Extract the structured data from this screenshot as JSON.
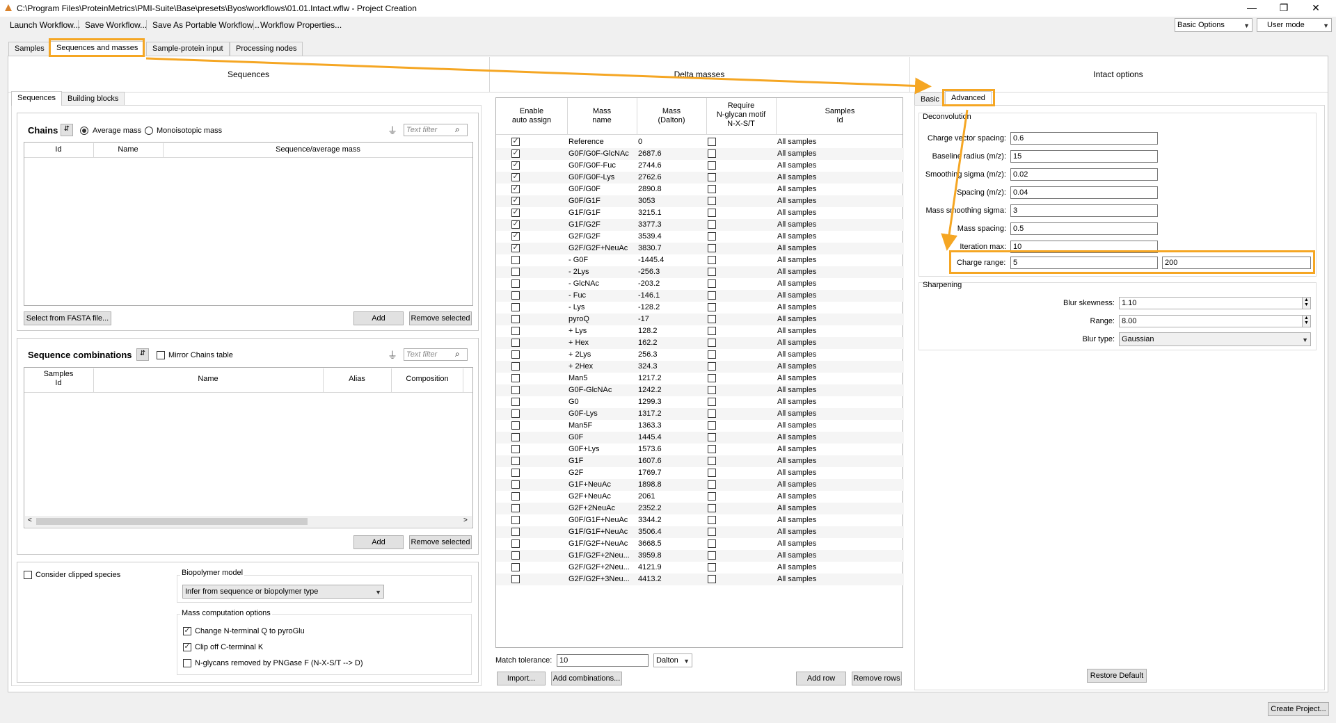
{
  "window": {
    "title": "C:\\Program Files\\ProteinMetrics\\PMI-Suite\\Base\\presets\\Byos\\workflows\\01.01.Intact.wflw - Project Creation",
    "minimize": "—",
    "restore": "❐",
    "close": "✕"
  },
  "menu": {
    "items": [
      "Launch Workflow...",
      "Save Workflow...",
      "Save As Portable Workflow...",
      "Workflow Properties..."
    ],
    "options_combo": "Basic Options",
    "mode_combo": "User mode"
  },
  "main_tabs": [
    "Samples",
    "Sequences and masses",
    "Sample-protein input",
    "Processing nodes"
  ],
  "sections": {
    "sequences": "Sequences",
    "delta": "Delta masses",
    "intact": "Intact options"
  },
  "seq_subtabs": [
    "Sequences",
    "Building blocks"
  ],
  "chains": {
    "title": "Chains",
    "avg_label": "Average mass",
    "mono_label": "Monoisotopic mass",
    "filter_placeholder": "Text filter",
    "headers": [
      "Id",
      "Name",
      "Sequence/average mass"
    ],
    "fasta_button": "Select from FASTA file...",
    "add": "Add",
    "remove": "Remove selected"
  },
  "combos": {
    "title": "Sequence combinations",
    "mirror_label": "Mirror Chains table",
    "filter_placeholder": "Text filter",
    "headers": [
      "Samples\nId",
      "Name",
      "Alias",
      "Composition"
    ],
    "add": "Add",
    "remove": "Remove selected"
  },
  "bottom_opts": {
    "clipped": "Consider clipped species",
    "biopolymer_label": "Biopolymer model",
    "biopolymer_value": "Infer from sequence or biopolymer type",
    "mass_comp_label": "Mass computation options",
    "opt1": "Change N-terminal Q to pyroGlu",
    "opt2": "Clip off C-terminal K",
    "opt3": "N-glycans removed by PNGase F (N-X-S/T --> D)"
  },
  "delta": {
    "headers": [
      "Enable\nauto assign",
      "Mass\nname",
      "Mass\n(Dalton)",
      "Require\nN-glycan motif\nN-X-S/T",
      "Samples\nId"
    ],
    "rows": [
      {
        "on": true,
        "name": "Reference",
        "mass": "0",
        "samples": "All samples"
      },
      {
        "on": true,
        "name": "G0F/G0F-GlcNAc",
        "mass": "2687.6",
        "samples": "All samples"
      },
      {
        "on": true,
        "name": "G0F/G0F-Fuc",
        "mass": "2744.6",
        "samples": "All samples"
      },
      {
        "on": true,
        "name": "G0F/G0F-Lys",
        "mass": "2762.6",
        "samples": "All samples"
      },
      {
        "on": true,
        "name": "G0F/G0F",
        "mass": "2890.8",
        "samples": "All samples"
      },
      {
        "on": true,
        "name": "G0F/G1F",
        "mass": "3053",
        "samples": "All samples"
      },
      {
        "on": true,
        "name": "G1F/G1F",
        "mass": "3215.1",
        "samples": "All samples"
      },
      {
        "on": true,
        "name": "G1F/G2F",
        "mass": "3377.3",
        "samples": "All samples"
      },
      {
        "on": true,
        "name": "G2F/G2F",
        "mass": "3539.4",
        "samples": "All samples"
      },
      {
        "on": true,
        "name": "G2F/G2F+NeuAc",
        "mass": "3830.7",
        "samples": "All samples"
      },
      {
        "on": false,
        "name": "- G0F",
        "mass": "-1445.4",
        "samples": "All samples"
      },
      {
        "on": false,
        "name": "- 2Lys",
        "mass": "-256.3",
        "samples": "All samples"
      },
      {
        "on": false,
        "name": "- GlcNAc",
        "mass": "-203.2",
        "samples": "All samples"
      },
      {
        "on": false,
        "name": "- Fuc",
        "mass": "-146.1",
        "samples": "All samples"
      },
      {
        "on": false,
        "name": "- Lys",
        "mass": "-128.2",
        "samples": "All samples"
      },
      {
        "on": false,
        "name": "pyroQ",
        "mass": "-17",
        "samples": "All samples"
      },
      {
        "on": false,
        "name": "+ Lys",
        "mass": "128.2",
        "samples": "All samples"
      },
      {
        "on": false,
        "name": "+ Hex",
        "mass": "162.2",
        "samples": "All samples"
      },
      {
        "on": false,
        "name": "+ 2Lys",
        "mass": "256.3",
        "samples": "All samples"
      },
      {
        "on": false,
        "name": "+ 2Hex",
        "mass": "324.3",
        "samples": "All samples"
      },
      {
        "on": false,
        "name": "Man5",
        "mass": "1217.2",
        "samples": "All samples"
      },
      {
        "on": false,
        "name": "G0F-GlcNAc",
        "mass": "1242.2",
        "samples": "All samples"
      },
      {
        "on": false,
        "name": "G0",
        "mass": "1299.3",
        "samples": "All samples"
      },
      {
        "on": false,
        "name": "G0F-Lys",
        "mass": "1317.2",
        "samples": "All samples"
      },
      {
        "on": false,
        "name": "Man5F",
        "mass": "1363.3",
        "samples": "All samples"
      },
      {
        "on": false,
        "name": "G0F",
        "mass": "1445.4",
        "samples": "All samples"
      },
      {
        "on": false,
        "name": "G0F+Lys",
        "mass": "1573.6",
        "samples": "All samples"
      },
      {
        "on": false,
        "name": "G1F",
        "mass": "1607.6",
        "samples": "All samples"
      },
      {
        "on": false,
        "name": "G2F",
        "mass": "1769.7",
        "samples": "All samples"
      },
      {
        "on": false,
        "name": "G1F+NeuAc",
        "mass": "1898.8",
        "samples": "All samples"
      },
      {
        "on": false,
        "name": "G2F+NeuAc",
        "mass": "2061",
        "samples": "All samples"
      },
      {
        "on": false,
        "name": "G2F+2NeuAc",
        "mass": "2352.2",
        "samples": "All samples"
      },
      {
        "on": false,
        "name": "G0F/G1F+NeuAc",
        "mass": "3344.2",
        "samples": "All samples"
      },
      {
        "on": false,
        "name": "G1F/G1F+NeuAc",
        "mass": "3506.4",
        "samples": "All samples"
      },
      {
        "on": false,
        "name": "G1F/G2F+NeuAc",
        "mass": "3668.5",
        "samples": "All samples"
      },
      {
        "on": false,
        "name": "G1F/G2F+2Neu...",
        "mass": "3959.8",
        "samples": "All samples"
      },
      {
        "on": false,
        "name": "G2F/G2F+2Neu...",
        "mass": "4121.9",
        "samples": "All samples"
      },
      {
        "on": false,
        "name": "G2F/G2F+3Neu...",
        "mass": "4413.2",
        "samples": "All samples"
      }
    ],
    "match_label": "Match tolerance:",
    "match_value": "10",
    "unit": "Dalton",
    "import": "Import...",
    "add_combos": "Add combinations...",
    "add_row": "Add row",
    "remove_rows": "Remove rows"
  },
  "intact": {
    "tabs": [
      "Basic",
      "Advanced"
    ],
    "deconv_title": "Deconvolution",
    "fields": [
      {
        "label": "Charge vector spacing:",
        "value": "0.6"
      },
      {
        "label": "Baseline radius (m/z):",
        "value": "15"
      },
      {
        "label": "Smoothing sigma (m/z):",
        "value": "0.02"
      },
      {
        "label": "Spacing (m/z):",
        "value": "0.04"
      },
      {
        "label": "Mass smoothing sigma:",
        "value": "3"
      },
      {
        "label": "Mass spacing:",
        "value": "0.5"
      },
      {
        "label": "Iteration max:",
        "value": "10"
      }
    ],
    "charge_label": "Charge range:",
    "charge_min": "5",
    "charge_max": "200",
    "sharpen_title": "Sharpening",
    "blur_skew_label": "Blur skewness:",
    "blur_skew": "1.10",
    "range_label": "Range:",
    "range": "8.00",
    "blur_type_label": "Blur type:",
    "blur_type": "Gaussian",
    "restore": "Restore Default"
  },
  "create_project": "Create Project...",
  "colors": {
    "highlight": "#f5a623",
    "tab_border": "#c8c8c8"
  }
}
